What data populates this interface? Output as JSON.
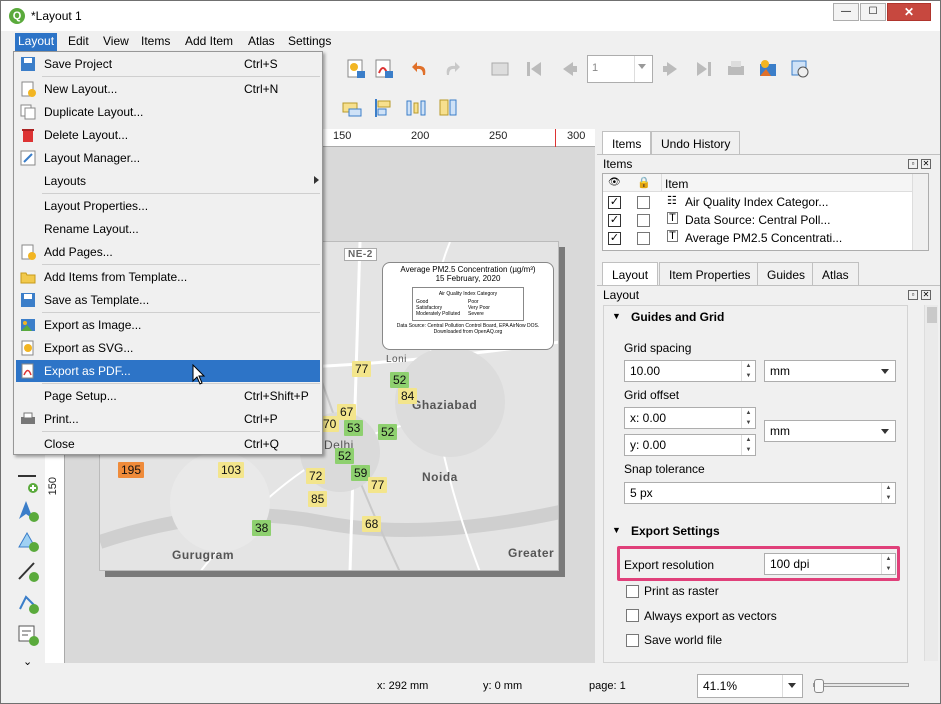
{
  "window": {
    "title": "*Layout 1",
    "min": "—",
    "max": "☐",
    "close": "✕"
  },
  "menubar": [
    "Layout",
    "Edit",
    "View",
    "Items",
    "Add Item",
    "Atlas",
    "Settings"
  ],
  "toolbar": {
    "page": "1"
  },
  "ruler": {
    "top": [
      "150",
      "200",
      "250",
      "300"
    ],
    "left": [
      "150"
    ]
  },
  "map": {
    "aqi": [
      {
        "v": "77",
        "c": "y"
      },
      {
        "v": "52",
        "c": "g"
      },
      {
        "v": "84",
        "c": "y"
      },
      {
        "v": "67",
        "c": "y"
      },
      {
        "v": "53",
        "c": "g"
      },
      {
        "v": "52",
        "c": "g"
      },
      {
        "v": "70",
        "c": "y"
      },
      {
        "v": "52",
        "c": "g"
      },
      {
        "v": "59",
        "c": "g"
      },
      {
        "v": "77",
        "c": "y"
      },
      {
        "v": "72",
        "c": "y"
      },
      {
        "v": "85",
        "c": "y"
      },
      {
        "v": "68",
        "c": "y"
      },
      {
        "v": "195",
        "c": "o"
      },
      {
        "v": "103",
        "c": "y"
      },
      {
        "v": "38",
        "c": "g"
      }
    ],
    "labels": {
      "ghaziabad": "Ghaziabad",
      "noida": "Noida",
      "gurugram": "Gurugram",
      "greater": "Greater",
      "loni": "Loni",
      "delhi": "Delhi",
      "ne2": "NE-2"
    },
    "legend": {
      "title": "Average PM2.5 Concentration (µg/m³)",
      "date": "15 February, 2020",
      "cat_title": "Air Quality Index Category",
      "cats": [
        "Good",
        "Poor",
        "Satisfactory",
        "Very Poor",
        "Moderately Polluted",
        "Severe"
      ],
      "source": "Data Source: Central Pollution Control Board, EPA AirNow DOS.",
      "download": "Downloaded from OpenAQ.org"
    }
  },
  "dropdown": [
    {
      "label": "Save Project",
      "shortcut": "Ctrl+S",
      "icon": "save-icon"
    },
    {
      "label": "New Layout...",
      "shortcut": "Ctrl+N",
      "icon": "new-layout-icon"
    },
    {
      "label": "Duplicate Layout...",
      "shortcut": "",
      "icon": "duplicate-icon"
    },
    {
      "label": "Delete Layout...",
      "shortcut": "",
      "icon": "delete-icon"
    },
    {
      "label": "Layout Manager...",
      "shortcut": "",
      "icon": "manager-icon"
    },
    {
      "label": "Layouts",
      "shortcut": "",
      "icon": ""
    },
    {
      "label": "Layout Properties...",
      "shortcut": "",
      "icon": ""
    },
    {
      "label": "Rename Layout...",
      "shortcut": "",
      "icon": ""
    },
    {
      "label": "Add Pages...",
      "shortcut": "",
      "icon": "add-pages-icon"
    },
    {
      "label": "Add Items from Template...",
      "shortcut": "",
      "icon": "folder-icon"
    },
    {
      "label": "Save as Template...",
      "shortcut": "",
      "icon": "save-template-icon"
    },
    {
      "label": "Export as Image...",
      "shortcut": "",
      "icon": "export-image-icon"
    },
    {
      "label": "Export as SVG...",
      "shortcut": "",
      "icon": "export-svg-icon"
    },
    {
      "label": "Export as PDF...",
      "shortcut": "",
      "icon": "export-pdf-icon"
    },
    {
      "label": "Page Setup...",
      "shortcut": "Ctrl+Shift+P",
      "icon": ""
    },
    {
      "label": "Print...",
      "shortcut": "Ctrl+P",
      "icon": "print-icon"
    },
    {
      "label": "Close",
      "shortcut": "Ctrl+Q",
      "icon": ""
    }
  ],
  "panel": {
    "tabs_top": [
      "Items",
      "Undo History"
    ],
    "items_title": "Items",
    "item_header": "Item",
    "items": [
      "Air Quality Index Categor...",
      "Data Source: Central Poll...",
      "Average PM2.5 Concentrati..."
    ],
    "tabs_bottom": [
      "Layout",
      "Item Properties",
      "Guides",
      "Atlas"
    ],
    "layout_title": "Layout",
    "guides_title": "Guides and Grid",
    "grid_spacing_label": "Grid spacing",
    "grid_spacing": "10.00",
    "grid_unit": "mm",
    "grid_offset_label": "Grid offset",
    "offset_x": "x: 0.00",
    "offset_y": "y: 0.00",
    "offset_unit": "mm",
    "snap_label": "Snap tolerance",
    "snap": "5 px",
    "export_title": "Export Settings",
    "export_res_label": "Export resolution",
    "export_res": "100 dpi",
    "print_raster": "Print as raster",
    "always_vectors": "Always export as vectors",
    "save_world": "Save world file"
  },
  "status": {
    "x": "x: 292 mm",
    "y": "y: 0 mm",
    "page": "page: 1",
    "zoom": "41.1%"
  }
}
